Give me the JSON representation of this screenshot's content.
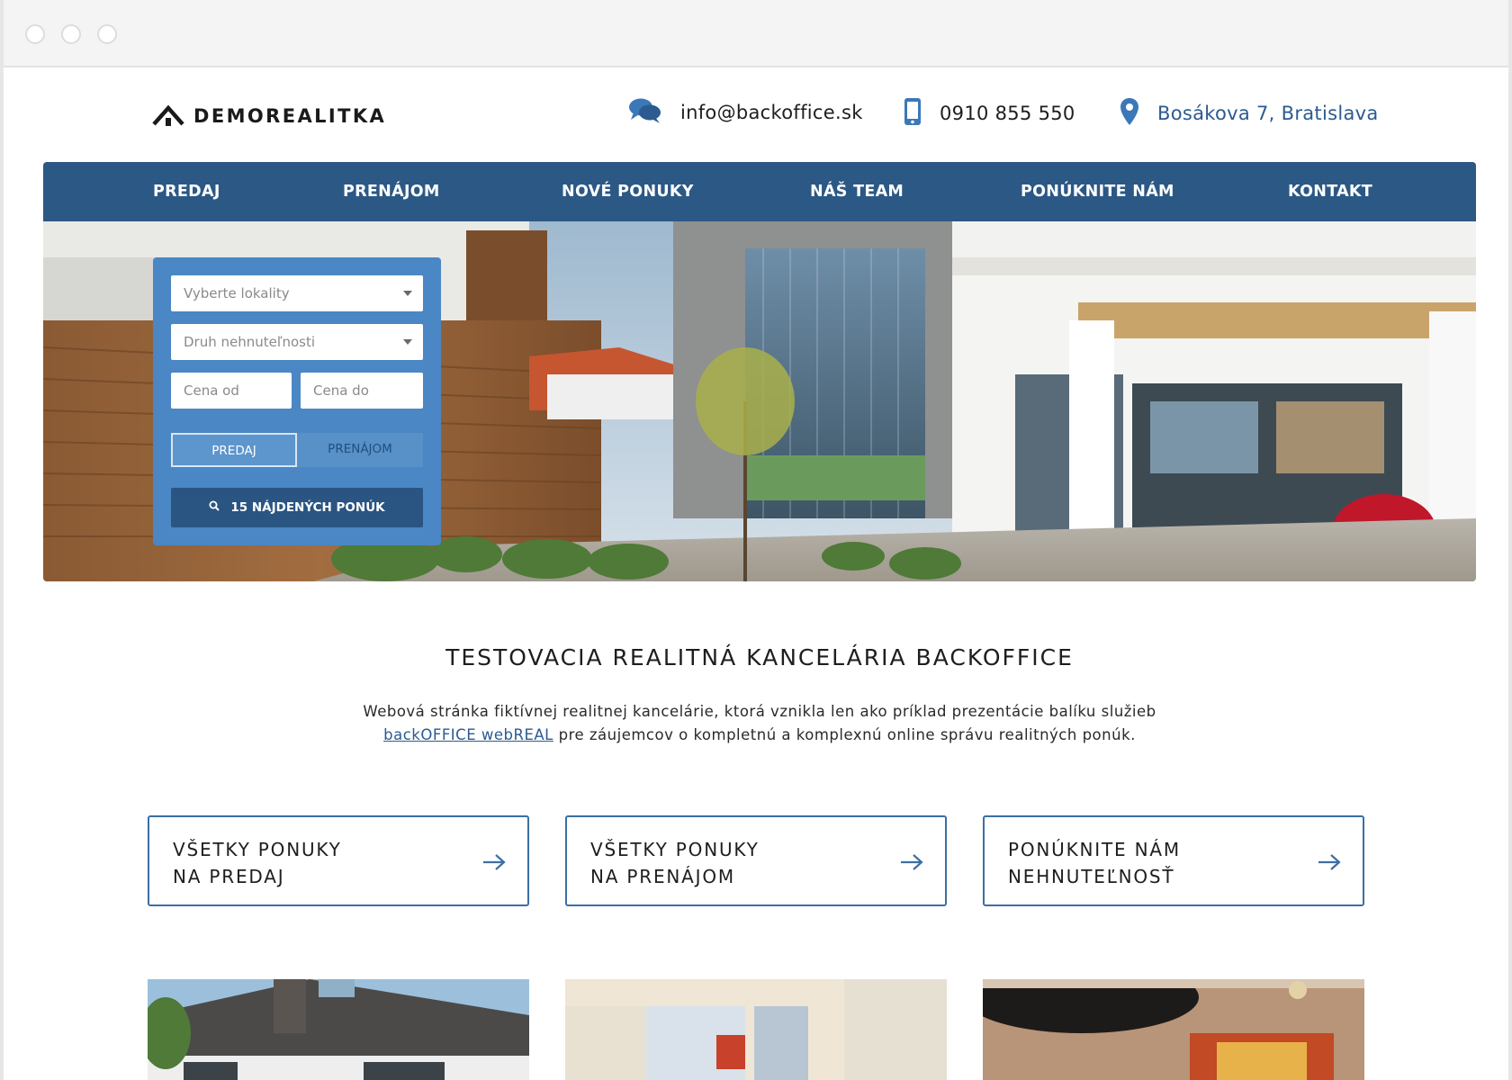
{
  "brand": {
    "name": "DEMOREALITKA"
  },
  "header": {
    "email": "info@backoffice.sk",
    "phone": "0910 855 550",
    "address": "Bosákova 7, Bratislava"
  },
  "nav": {
    "items": [
      {
        "label": "PREDAJ"
      },
      {
        "label": "PRENÁJOM"
      },
      {
        "label": "NOVÉ PONUKY"
      },
      {
        "label": "NÁŠ TEAM"
      },
      {
        "label": "PONÚKNITE NÁM"
      },
      {
        "label": "KONTAKT"
      }
    ]
  },
  "search": {
    "location_placeholder": "Vyberte lokality",
    "type_placeholder": "Druh nehnuteľnosti",
    "price_from_placeholder": "Cena od",
    "price_to_placeholder": "Cena do",
    "toggle_sale": "PREDAJ",
    "toggle_rent": "PRENÁJOM",
    "active_toggle": "PREDAJ",
    "button_label": "15 NÁJDENÝCH PONÚK"
  },
  "intro": {
    "title": "TESTOVACIA REALITNÁ KANCELÁRIA BACKOFFICE",
    "text_before": "Webová stránka fiktívnej realitnej kancelárie, ktorá vznikla len ako príklad prezentácie balíku služieb",
    "link_text": "backOFFICE webREAL",
    "text_after": " pre záujemcov o kompletnú a komplexnú online správu realitných ponúk."
  },
  "ctas": [
    {
      "line1": "VŠETKY PONUKY",
      "line2": "NA PREDAJ"
    },
    {
      "line1": "VŠETKY PONUKY",
      "line2": "NA PRENÁJOM"
    },
    {
      "line1": "PONÚKNITE NÁM",
      "line2": "NEHNUTEĽNOSŤ"
    }
  ],
  "colors": {
    "primary": "#2c5885",
    "panel": "#4a87c4",
    "accent": "#3c6fa4",
    "link": "#2b5b90"
  },
  "icons": {
    "logo": "house-roof-icon",
    "email": "chat-bubbles-icon",
    "phone": "mobile-phone-icon",
    "address": "map-pin-icon",
    "search": "search-icon",
    "cta": "arrow-right-icon"
  }
}
